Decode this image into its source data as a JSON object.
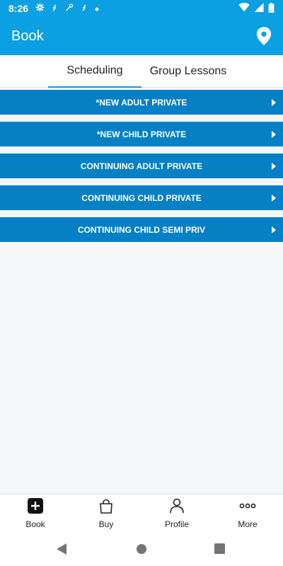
{
  "status": {
    "time": "8:26",
    "icons": [
      "gear-icon",
      "link-icon",
      "wrench-icon",
      "link-icon",
      "dot-icon"
    ],
    "right_icons": [
      "wifi-icon",
      "signal-icon",
      "battery-icon"
    ]
  },
  "app_bar": {
    "title": "Book",
    "icon": "location-pin-icon"
  },
  "tabs": [
    {
      "label": "Scheduling",
      "active": true
    },
    {
      "label": "Group Lessons",
      "active": false
    }
  ],
  "menu": [
    {
      "label": "*NEW ADULT PRIVATE"
    },
    {
      "label": "*NEW CHILD PRIVATE"
    },
    {
      "label": "CONTINUING ADULT PRIVATE"
    },
    {
      "label": "CONTINUING CHILD PRIVATE"
    },
    {
      "label": "CONTINUING CHILD SEMI PRIV"
    }
  ],
  "bottom_nav": [
    {
      "label": "Book",
      "icon": "plus-square-icon"
    },
    {
      "label": "Buy",
      "icon": "shopping-bag-icon"
    },
    {
      "label": "Profile",
      "icon": "person-icon"
    },
    {
      "label": "More",
      "icon": "more-dots-icon"
    }
  ],
  "colors": {
    "primary": "#0aa0e2",
    "menu_bg": "#0680c5",
    "content_bg": "#f5f6f8"
  }
}
